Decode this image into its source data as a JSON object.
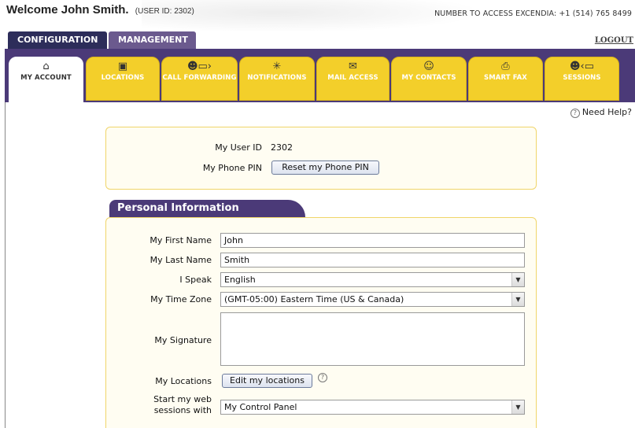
{
  "header": {
    "welcome": "Welcome John Smith.",
    "user_id_tag": "(USER ID: 2302)",
    "access_number": "NUMBER TO ACCESS EXCENDIA: +1 (514) 765 8499",
    "logout": "LOGOUT"
  },
  "top_tabs": {
    "configuration": "CONFIGURATION",
    "management": "MANAGEMENT"
  },
  "sub_tabs": [
    {
      "label": "MY ACCOUNT",
      "icon": "home-icon"
    },
    {
      "label": "LOCATIONS",
      "icon": "phone-book-icon"
    },
    {
      "label": "CALL FORWARDING",
      "icon": "call-forward-icon"
    },
    {
      "label": "NOTIFICATIONS",
      "icon": "notification-icon"
    },
    {
      "label": "MAIL ACCESS",
      "icon": "mail-icon"
    },
    {
      "label": "MY CONTACTS",
      "icon": "contacts-icon"
    },
    {
      "label": "SMART FAX",
      "icon": "fax-icon"
    },
    {
      "label": "SESSIONS",
      "icon": "sessions-icon"
    }
  ],
  "help": {
    "label": "Need Help?",
    "icon": "question-icon"
  },
  "account": {
    "user_id_label": "My User ID",
    "user_id_value": "2302",
    "phone_pin_label": "My Phone PIN",
    "reset_pin_button": "Reset my Phone PIN"
  },
  "personal": {
    "section_title": "Personal Information",
    "first_name_label": "My First Name",
    "first_name_value": "John",
    "last_name_label": "My Last Name",
    "last_name_value": "Smith",
    "speak_label": "I Speak",
    "speak_value": "English",
    "timezone_label": "My Time Zone",
    "timezone_value": "(GMT-05:00) Eastern Time (US & Canada)",
    "signature_label": "My Signature",
    "signature_value": "",
    "locations_label": "My Locations",
    "edit_locations_button": "Edit my locations",
    "start_sessions_label_1": "Start my web",
    "start_sessions_label_2": "sessions with",
    "start_sessions_value": "My Control Panel"
  }
}
